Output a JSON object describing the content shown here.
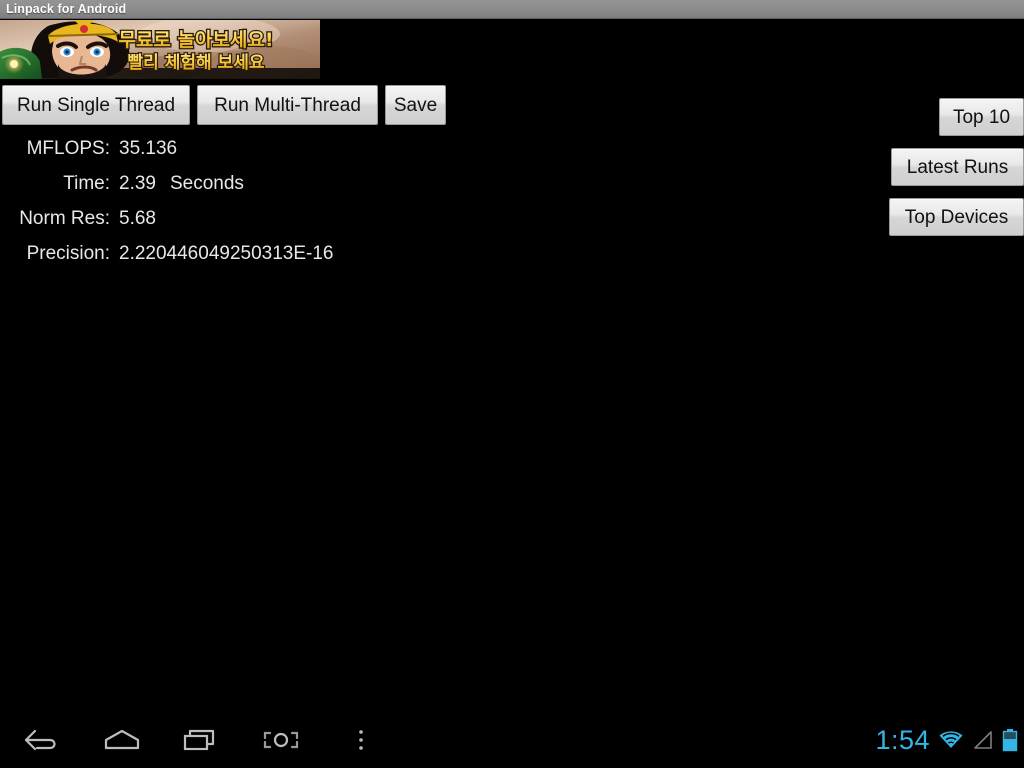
{
  "window": {
    "title": "Linpack for Android"
  },
  "ad_banner": {
    "name": "game-ad-banner",
    "headline": "무료로 놀아보세요!",
    "subline": "빨리 체험해 보세요"
  },
  "toolbar": {
    "run_single_thread": "Run Single Thread",
    "run_multi_thread": "Run Multi-Thread",
    "save": "Save"
  },
  "side_buttons": {
    "top10": "Top 10",
    "latest_runs": "Latest Runs",
    "top_devices": "Top Devices"
  },
  "results": [
    {
      "label": "MFLOPS:",
      "value": "35.136",
      "unit": ""
    },
    {
      "label": "Time:",
      "value": "2.39",
      "unit": "Seconds"
    },
    {
      "label": "Norm Res:",
      "value": "5.68",
      "unit": ""
    },
    {
      "label": "Precision:",
      "value": "2.220446049250313E-16",
      "unit": ""
    }
  ],
  "navbar": {
    "back": "back-icon",
    "home": "home-icon",
    "recents": "recents-icon",
    "screenshot": "screenshot-icon",
    "menu": "overflow-menu-icon"
  },
  "status": {
    "clock": "1:54",
    "wifi": "wifi-icon",
    "signal": "cell-signal-icon",
    "battery": "battery-icon"
  },
  "colors": {
    "accent": "#33b5e5",
    "titlebar": "#8b8b8b",
    "background": "#000000",
    "button_face": "#e9e9e9",
    "text": "#e8e8e8"
  }
}
